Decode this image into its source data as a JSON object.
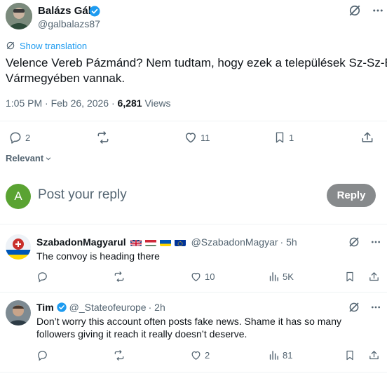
{
  "main_tweet": {
    "author_name": "Balázs Gál",
    "author_handle": "@galbalazs87",
    "show_translation": "Show translation",
    "text_line1": "Velence Vereb Pázmánd? Nem tudtam, hogy ezek a települések Sz-Sz-B.",
    "text_line2": "Vármegyében vannak.",
    "time": "1:05 PM · Feb 26, 2026 · ",
    "views_count": "6,281",
    "views_label": " Views",
    "replies": "2",
    "likes": "11",
    "bookmarks": "1"
  },
  "sort": {
    "label": "Relevant"
  },
  "composer": {
    "avatar_letter": "A",
    "avatar_color": "#5aa332",
    "placeholder": "Post your reply",
    "reply_button": "Reply"
  },
  "replies": [
    {
      "author_name": "SzabadonMagyarul",
      "author_handle": "@SzabadonMagyar",
      "time": "· 5h",
      "text": "The convoy is heading there",
      "likes": "10",
      "views": "5K"
    },
    {
      "author_name": "Tim",
      "author_handle": "@_Stateofeurope",
      "time": "· 2h",
      "text_line1": "Don’t worry this account often posts fake news. Shame it has so many",
      "text_line2": "followers giving it reach it really doesn’t deserve.",
      "likes": "2",
      "views": "81"
    }
  ],
  "colors": {
    "accent": "#1d9bf0",
    "muted": "#536471",
    "reply_button_bg": "#878a8c"
  }
}
